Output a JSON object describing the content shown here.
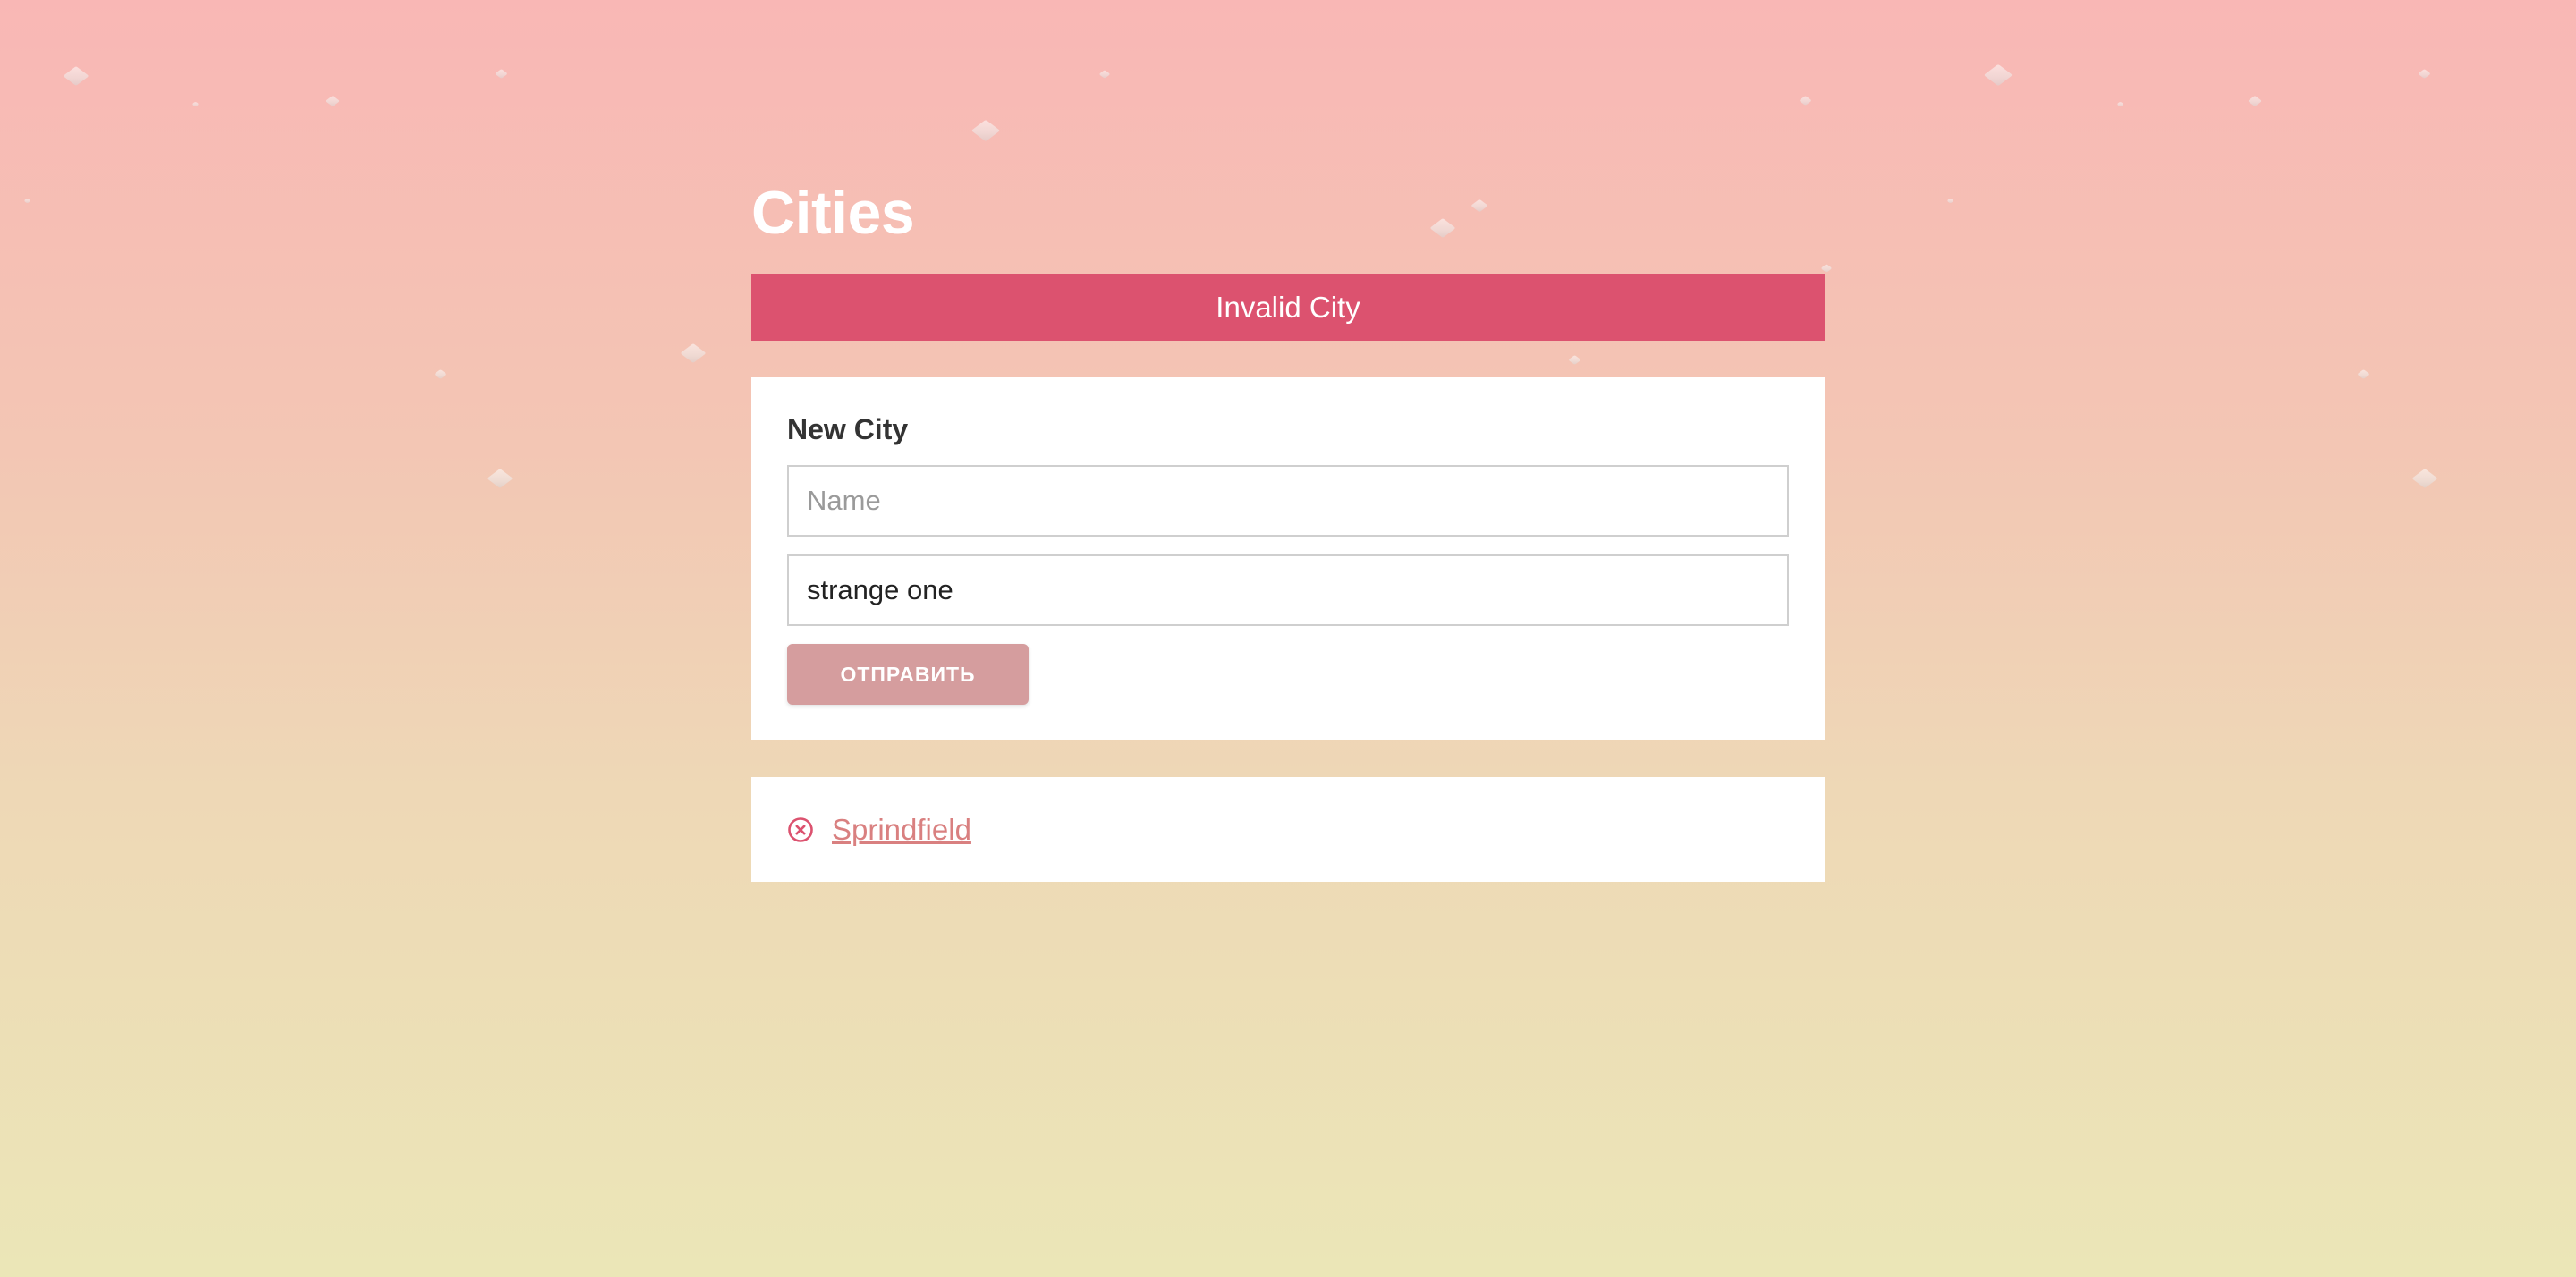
{
  "page": {
    "title": "Cities"
  },
  "error": {
    "message": "Invalid City"
  },
  "form": {
    "title": "New City",
    "name_placeholder": "Name",
    "name_value": "",
    "description_value": "strange one",
    "submit_label": "ОТПРАВИТЬ"
  },
  "cities": {
    "items": [
      {
        "name": "Sprindfield",
        "remove_icon": "circle-x-icon"
      }
    ]
  },
  "colors": {
    "error_banner": "#dc526f",
    "submit_button": "#d59d9e",
    "link": "#d98080",
    "remove_icon": "#dc526f"
  }
}
